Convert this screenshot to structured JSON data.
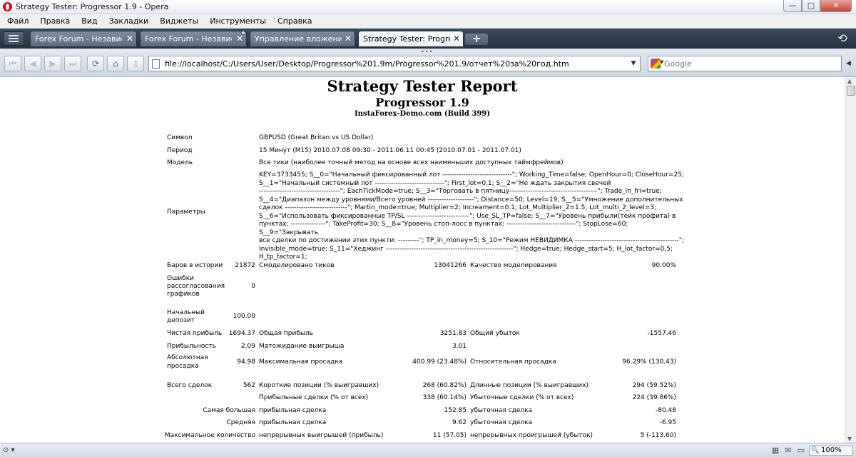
{
  "window": {
    "title": "Strategy Tester: Progressor 1.9 - Opera",
    "buttons": {
      "min": "—",
      "max": "□",
      "close": "✕"
    }
  },
  "menu": [
    "Файл",
    "Правка",
    "Вид",
    "Закладки",
    "Виджеты",
    "Инструменты",
    "Справка"
  ],
  "tabs": [
    {
      "label": "Forex Forum - Независи...",
      "close": "✕"
    },
    {
      "label": "Forex Forum - Независи...",
      "close": "✕"
    },
    {
      "label": "Управление вложения...",
      "close": "✕"
    },
    {
      "label": "Strategy Tester: Progress...",
      "close": "✕"
    }
  ],
  "new_tab_label": "+",
  "toolbar": {
    "grip": "•••",
    "url": "file://localhost/C:/Users/User/Desktop/Progressor%201.9m/Progressor%201.9/отчет%20за%20год.htm",
    "search_placeholder": "Google"
  },
  "report": {
    "title": "Strategy Tester Report",
    "ea": "Progressor 1.9",
    "server": "InstaForex-Demo.com (Build 399)",
    "info": [
      {
        "label": "Символ",
        "value": "GBPUSD (Great Britan vs US Dollar)"
      },
      {
        "label": "Период",
        "value": "15 Минут (M15) 2010.07.08 09:30 - 2011.06.11 00:45 (2010.07.01 - 2011.07.01)"
      },
      {
        "label": "Модель",
        "value": "Все тики (наиболее точный метод на основе всех наименьших доступных таймфреймов)"
      }
    ],
    "params_label": "Параметры",
    "params_lines": [
      "KEY=3733455; S__0=\"Начальный фиксированный лот ------------------------------\"; Working_Time=false; OpenHour=0; CloseHour=25;",
      "S__1=\"Начальный системный лот ------------------------------\"; First_lot=0.1; S__2=\"Не ждать закрытия свечей",
      "-----------------------------------\"; EachTickMode=true; S__3=\"Торговать в пятницу--------------------------------------\"; Trade_in_fri=true;",
      "S__4=\"Диапазон между уровнями/Всего уровней --------------------\"; Distance=50; Level=19; S__5=\"Умножение дополнительных",
      "сделок ---------------------------\"; Martin_mode=true; Multiplier=2; Increament=0.1; Lot_Multiplier_2=1.5; Lot_multi_2_level=3;",
      "S__6=\"Использовать фиксированные TP/SL ---------------------------\"; Use_SL_TP=false; S__7=\"Уровень прибыли(тейк профита) в",
      "пунктах: ---------------\"; TakeProfit=30; S__8=\"Уровень стоп-лосс в пунктах: ------------------------------\"; StopLose=60; S__9=\"Закрывать",
      "все сделки по достижении этих пункти: ---------\"; TP_in_money=5; S_10=\"Режим НЕВИДИМКА ---------------------------------------------\";",
      "Invisible_mode=true; S_11=\"Хеджинг -------------------------------------------------------\"; Hedge=true; Hedge_start=5; H_lot_factor=0.5;",
      "H_tp_factor=1;"
    ],
    "stats": {
      "bars_label": "Баров в истории",
      "bars": "21872",
      "ticks_label": "Смоделировано тиков",
      "ticks": "13041266",
      "quality_label": "Качество моделирования",
      "quality": "90.00%",
      "mismatch_label_1": "Ошибки",
      "mismatch_label_2": "рассогласования",
      "mismatch_label_3": "графиков",
      "mismatch": "0",
      "deposit_label_1": "Начальный",
      "deposit_label_2": "депозит",
      "deposit": "100.00",
      "net_label": "Чистая прибыль",
      "net": "1694.37",
      "gross_profit_label": "Общая прибыль",
      "gross_profit": "3251.83",
      "gross_loss_label": "Общий убыток",
      "gross_loss": "-1557.46",
      "pf_label": "Прибыльность",
      "pf": "2.09",
      "payoff_label": "Матожидание выигрыша",
      "payoff": "3.01",
      "abs_dd_label_1": "Абсолютная",
      "abs_dd_label_2": "просадка",
      "abs_dd": "94.98",
      "max_dd_label": "Максимальная просадка",
      "max_dd": "400.99 (23.48%)",
      "rel_dd_label": "Относительная просадка",
      "rel_dd": "96.29% (130.43)",
      "trades_label": "Всего сделок",
      "trades": "562",
      "short_label": "Короткие позиции (% выигравших)",
      "short": "268 (60.82%)",
      "long_label": "Длинные позиции (% выигравших)",
      "long": "294 (59.52%)",
      "profit_trades_label": "Прибыльные сделки (% от всех)",
      "profit_trades": "338 (60.14%)",
      "loss_trades_label": "Убыточные сделки (% от всех)",
      "loss_trades": "224 (39.86%)",
      "largest_label": "Самая большая",
      "largest_profit_label": "прибыльная сделка",
      "largest_profit": "152.85",
      "largest_loss_label": "убыточная сделка",
      "largest_loss": "-80.48",
      "average_label": "Средняя",
      "average_profit_label": "прибыльная сделка",
      "average_profit": "9.62",
      "average_loss_label": "убыточная сделка",
      "average_loss": "-6.95",
      "max_count_label": "Максимальное количество",
      "cons_wins_label": "непрерывных выигрышей (прибыль)",
      "cons_wins": "11 (57.05)",
      "cons_losses_label": "непрерывных проигрышей (убыток)",
      "cons_losses": "5 (-113.60)"
    }
  },
  "status": {
    "zoom": "100%"
  }
}
